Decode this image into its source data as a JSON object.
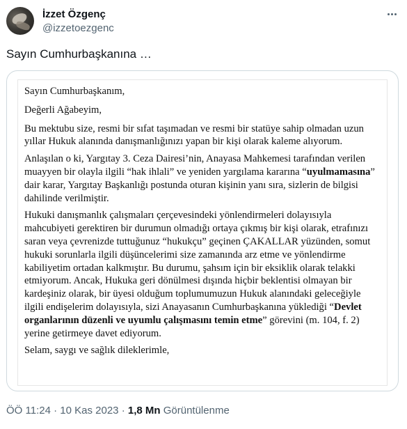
{
  "author": {
    "name": "İzzet Özgenç",
    "handle": "@izzetoezgenc"
  },
  "tweet": {
    "text": "Sayın Cumhurbaşkanına …"
  },
  "document": {
    "salutation": "Sayın Cumhurbaşkanım,",
    "greeting": "Değerli Ağabeyim,",
    "p1": "Bu mektubu size, resmi bir sıfat taşımadan ve resmi bir statüye sahip olmadan uzun yıllar Hukuk alanında danışmanlığınızı yapan bir kişi olarak kaleme alıyorum.",
    "p2_a": "Anlaşılan o ki, Yargıtay 3. Ceza Dairesi’nin, Anayasa Mahkemesi tarafından verilen muayyen bir olayla ilgili “hak ihlali” ve yeniden yargılama kararına “",
    "p2_bold": "uyulmamasına",
    "p2_b": "” dair karar, Yargıtay Başkanlığı postunda oturan kişinin yanı sıra, sizlerin de bilgisi dahilinde verilmiştir.",
    "p3_a": "Hukuki danışmanlık çalışmaları çerçevesindeki yönlendirmeleri dolayısıyla mahcubiyeti gerektiren bir durumun olmadığı ortaya çıkmış bir kişi olarak, etrafınızı saran veya çevrenizde tuttuğunuz “hukukçu” geçinen ÇAKALLAR yüzünden, somut hukuki sorunlarla ilgili düşüncelerimi size zamanında arz etme ve yönlendirme kabiliyetim ortadan kalkmıştır. Bu durumu, şahsım için bir eksiklik olarak telakki etmiyorum. Ancak, Hukuka geri dönülmesi dışında hiçbir beklentisi olmayan bir kardeşiniz olarak, bir üyesi olduğum toplumumuzun Hukuk alanındaki geleceğiyle ilgili endişelerim dolayısıyla, sizi Anayasanın Cumhurbaşkanına yüklediği “",
    "p3_bold": "Devlet organlarının düzenli ve uyumlu çalışmasını temin etme",
    "p3_b": "” görevini (m. 104, f. 2) yerine getirmeye davet ediyorum.",
    "closing": "Selam, saygı ve sağlık dileklerimle,"
  },
  "meta": {
    "time": "ÖÖ 11:24",
    "sep1": " · ",
    "date": "10 Kas 2023",
    "sep2": " · ",
    "views_count": "1,8 Mn",
    "views_label": " Görüntülenme"
  }
}
